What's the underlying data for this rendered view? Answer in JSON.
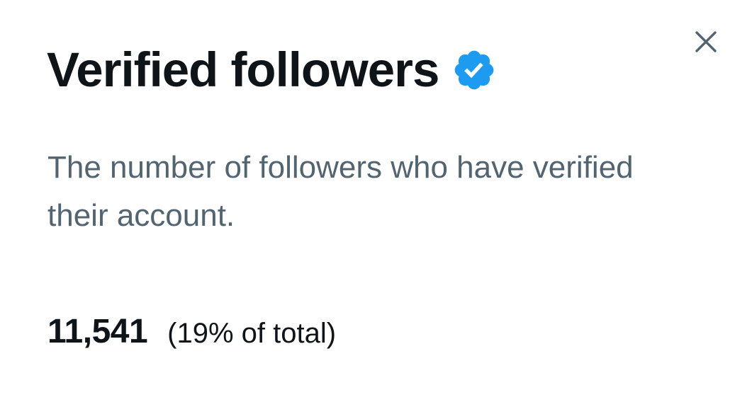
{
  "dialog": {
    "title": "Verified followers",
    "badge_icon": "verified-badge-icon",
    "badge_color": "#1d9bf0",
    "description": "The number of followers who have verified their account.",
    "stat": {
      "value": "11,541",
      "percent_text": "(19% of total)"
    },
    "close_icon": "close-icon"
  },
  "colors": {
    "title": "#0f1419",
    "description": "#536471",
    "close": "#536471",
    "background": "#ffffff"
  }
}
